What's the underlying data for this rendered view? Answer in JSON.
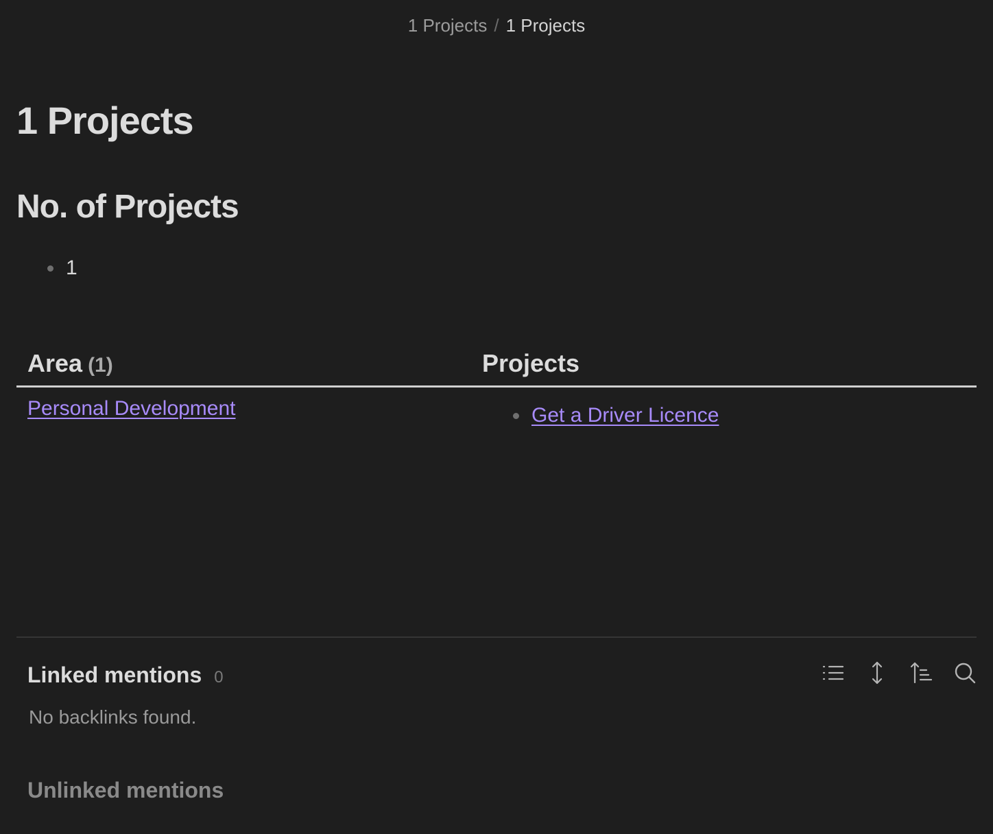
{
  "breadcrumb": {
    "parent": "1 Projects",
    "separator": "/",
    "current": "1 Projects"
  },
  "title": "1 Projects",
  "section_heading": "No. of Projects",
  "project_count_items": [
    "1"
  ],
  "table": {
    "col_area": "Area",
    "col_area_count": "(1)",
    "col_projects": "Projects",
    "rows": [
      {
        "area": "Personal Development",
        "projects": [
          "Get a Driver Licence"
        ]
      }
    ]
  },
  "backlinks": {
    "linked_title": "Linked mentions",
    "linked_count": "0",
    "empty_text": "No backlinks found.",
    "unlinked_title": "Unlinked mentions",
    "icons": [
      "list-icon",
      "expand-collapse-icon",
      "sort-icon",
      "search-icon"
    ]
  },
  "colors": {
    "background": "#1e1e1e",
    "link": "#a88bfa",
    "text": "#dadada",
    "muted": "#9a9a9a"
  }
}
